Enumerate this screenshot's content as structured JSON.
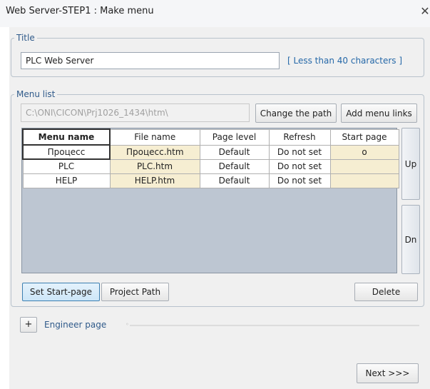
{
  "window": {
    "title": "Web Server-STEP1 : Make menu",
    "close_glyph": "✕"
  },
  "title_section": {
    "legend": "Title",
    "value": "PLC Web Server",
    "hint": "[ Less than 40 characters ]"
  },
  "menu_list": {
    "legend": "Menu list",
    "path": "C:\\ONI\\CICON\\Prj1026_1434\\htm\\",
    "change_path_label": "Change the path",
    "add_links_label": "Add menu links",
    "columns": [
      "Menu name",
      "File name",
      "Page level",
      "Refresh",
      "Start page"
    ],
    "rows": [
      {
        "menu_name": "Процесс",
        "file_name": "Процесс.htm",
        "page_level": "Default",
        "refresh": "Do not set",
        "start_page": "o"
      },
      {
        "menu_name": "PLC",
        "file_name": "PLC.htm",
        "page_level": "Default",
        "refresh": "Do not set",
        "start_page": ""
      },
      {
        "menu_name": "HELP",
        "file_name": "HELP.htm",
        "page_level": "Default",
        "refresh": "Do not set",
        "start_page": ""
      }
    ],
    "up_label": "Up",
    "down_label": "Dn",
    "set_start_label": "Set Start-page",
    "project_path_label": "Project Path",
    "delete_label": "Delete"
  },
  "engineer": {
    "toggle_glyph": "+",
    "label": "Engineer page"
  },
  "footer": {
    "next_label": "Next >>>"
  }
}
